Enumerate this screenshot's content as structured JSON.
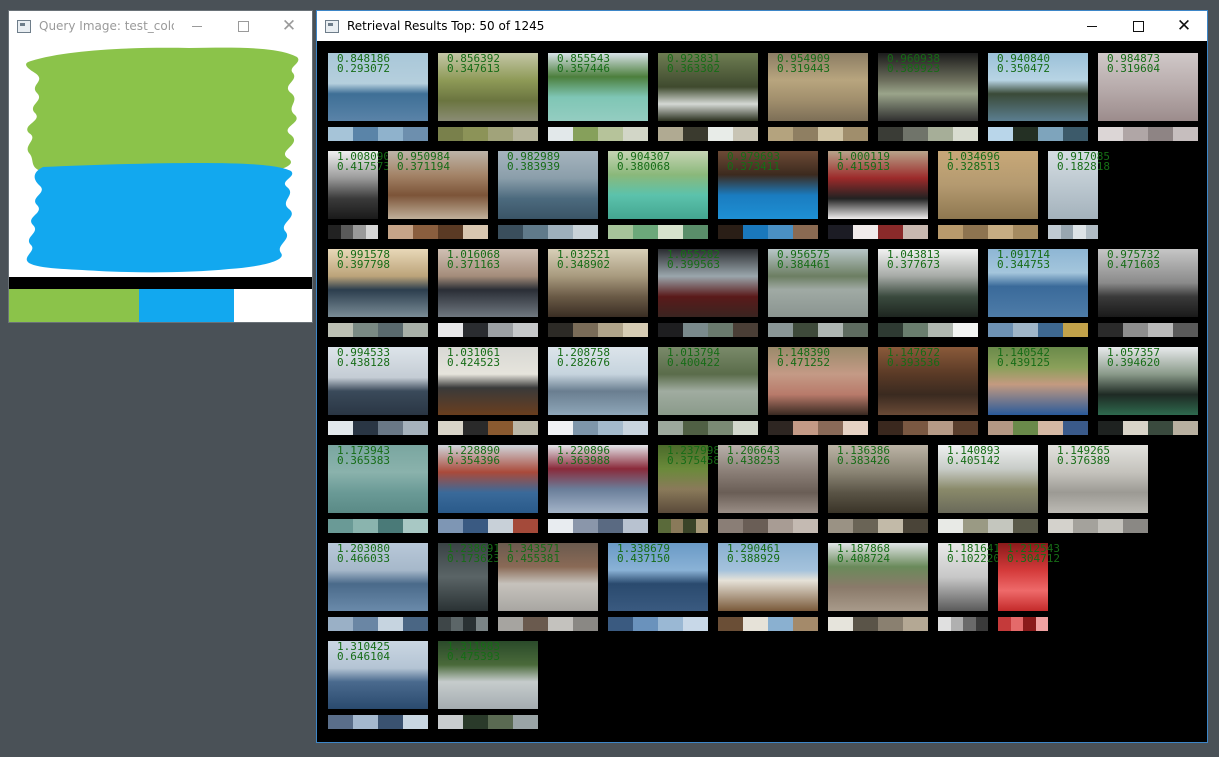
{
  "query_window": {
    "title": "Query Image: test_color...",
    "swatches": [
      "#8bc34a",
      "#12a8ef",
      "#ffffff"
    ]
  },
  "results_window": {
    "title": "Retrieval Results Top: 50 of 1245",
    "results": [
      {
        "s1": "0.848186",
        "s2": "0.293072",
        "img": "linear-gradient(#a9c7d8 0%,#b5cfdd 45%,#3e6f96 60%,#5a83a8 100%)",
        "colors": [
          "#a6c4d8",
          "#5a84a8",
          "#8fb2cc",
          "#6d8fae"
        ]
      },
      {
        "s1": "0.856392",
        "s2": "0.347613",
        "img": "linear-gradient(#c4c6a6 0%,#8e9a57 40%,#6b7540 70%,#8a8c74 100%)",
        "colors": [
          "#79804b",
          "#8c9358",
          "#a1a37a",
          "#b5b49a"
        ]
      },
      {
        "s1": "0.855543",
        "s2": "0.357446",
        "img": "linear-gradient(#d8e2e8 0%,#4c7f3c 35%,#7fc6b5 65%,#94cdc1 100%)",
        "colors": [
          "#e2e8ea",
          "#86a05b",
          "#b6c39a",
          "#d2d6c7"
        ]
      },
      {
        "s1": "0.923831",
        "s2": "0.363302",
        "img": "linear-gradient(#6e7d52 0%,#3f4a2e 50%,#d4d8d4 75%,#2c3220 100%)",
        "colors": [
          "#b0aa92",
          "#3a3a2e",
          "#e8ece8",
          "#c8c4b4"
        ]
      },
      {
        "s1": "0.954909",
        "s2": "0.319443",
        "img": "linear-gradient(#8c7d64 0%,#b8a57e 40%,#a08e6c 70%,#7d6f57 100%)",
        "colors": [
          "#b4a37e",
          "#8f7f62",
          "#d0c4a4",
          "#a08e6c"
        ]
      },
      {
        "s1": "0.960938",
        "s2": "0.389923",
        "img": "linear-gradient(#1c1c1c 0%,#6c6e5c 40%,#9aa48a 60%,#303030 100%)",
        "colors": [
          "#3a3c36",
          "#70746a",
          "#a6ae98",
          "#d8dcd0"
        ]
      },
      {
        "s1": "0.940840",
        "s2": "0.350472",
        "img": "linear-gradient(#9bc1d9 0%,#b8d4e4 40%,#3a4a38 60%,#5b7e90 100%)",
        "colors": [
          "#b9d6ea",
          "#243024",
          "#7ea4bc",
          "#3c5a6a"
        ]
      },
      {
        "s1": "0.984873",
        "s2": "0.319604",
        "img": "linear-gradient(#d0c8c8 0%,#b8acac 50%,#9c8c8c 100%)",
        "colors": [
          "#dcd6d6",
          "#b0a6a6",
          "#8e8484",
          "#c6bebe"
        ]
      },
      {
        "s1": "1.008090",
        "s2": "0.417573",
        "img": "linear-gradient(#f0f0f0 0%,#9a9a9a 40%,#3a3a3a 70%,#1a1a1a 100%)",
        "colors": [
          "#222222",
          "#5a5a5a",
          "#9a9a9a",
          "#d6d6d6"
        ]
      },
      {
        "s1": "0.950984",
        "s2": "0.371194",
        "img": "linear-gradient(#bdb4a8 0%,#a48468 35%,#7c5438 65%,#c0b09a 100%)",
        "colors": [
          "#c6a488",
          "#8a5e3e",
          "#5a3a24",
          "#d8c6b0"
        ]
      },
      {
        "s1": "0.982989",
        "s2": "0.383939",
        "img": "linear-gradient(#a6b4be 0%,#8a9eaa 40%,#4c6a7e 70%,#3a5466 100%)",
        "colors": [
          "#3a4e5c",
          "#607a8a",
          "#9eb0bc",
          "#c8d2d8"
        ]
      },
      {
        "s1": "0.904307",
        "s2": "0.380068",
        "img": "linear-gradient(#c6d4b4 0%,#8ab87a 35%,#5bc2ac 65%,#44a690 100%)",
        "colors": [
          "#a6c49a",
          "#6ca87a",
          "#d6e2cc",
          "#5a8e6a"
        ]
      },
      {
        "s1": "0.979693",
        "s2": "0.373411",
        "img": "linear-gradient(#6c4a36 0%,#3c2a1e 35%,#1a7cc0 65%,#1e90d4 100%)",
        "colors": [
          "#2a1e16",
          "#1a78bc",
          "#4a90c4",
          "#8a6a52"
        ]
      },
      {
        "s1": "1.000119",
        "s2": "0.415913",
        "img": "linear-gradient(#b8a48a 0%,#9c2a2a 40%,#222222 70%,#f0eeee 100%)",
        "colors": [
          "#1c1c24",
          "#f0eaea",
          "#8a2a2a",
          "#c8b8b0"
        ]
      },
      {
        "s1": "1.034696",
        "s2": "0.328513",
        "img": "linear-gradient(#c8a878 0%,#b49a70 50%,#8e7850 100%)",
        "colors": [
          "#b89a6c",
          "#8e7450",
          "#c6ac82",
          "#a48a60"
        ]
      },
      {
        "s1": "0.917085",
        "s2": "0.182818",
        "img": "linear-gradient(#d6dde2 0%,#bcc8d0 50%,#a4b2bc 100%)",
        "colors": [
          "#c0cad2",
          "#98a6b0",
          "#dce2e6",
          "#b0bcc4"
        ]
      },
      {
        "s1": "0.991578",
        "s2": "0.397798",
        "img": "linear-gradient(#e8d8b8 0%,#bca47a 40%,#2c3e4e 60%,#7a8c96 100%)",
        "colors": [
          "#bcc0b4",
          "#7a8a84",
          "#5a6a6e",
          "#a8b0a8"
        ]
      },
      {
        "s1": "1.016068",
        "s2": "0.371163",
        "img": "linear-gradient(#d0c0b4 0%,#a48c7a 40%,#2a2e36 60%,#707880 100%)",
        "colors": [
          "#e8e8ea",
          "#2a2c30",
          "#9ca0a4",
          "#c6c8ca"
        ]
      },
      {
        "s1": "1.032521",
        "s2": "0.348902",
        "img": "linear-gradient(#d8d0b8 0%,#a89a7e 40%,#6a5a46 70%,#3a2e24 100%)",
        "colors": [
          "#2c2a26",
          "#7a6c58",
          "#b0a48a",
          "#d6ccb4"
        ]
      },
      {
        "s1": "1.055282",
        "s2": "0.399563",
        "img": "linear-gradient(#2a2c30 0%,#9aa6ac 40%,#5a1a1a 70%,#3a2420 100%)",
        "colors": [
          "#1e1e20",
          "#7a8a8c",
          "#6a7a6e",
          "#4a3e36"
        ]
      },
      {
        "s1": "0.956575",
        "s2": "0.384461",
        "img": "linear-gradient(#b8c6c8 0%,#6c7e62 40%,#a0aaa4 60%,#8a9490 100%)",
        "colors": [
          "#8a9696",
          "#3e4a3a",
          "#aeb6b2",
          "#5e6c60"
        ]
      },
      {
        "s1": "1.043813",
        "s2": "0.377673",
        "img": "linear-gradient(#f2f2f2 0%,#a6aaa6 40%,#3a4a3e 70%,#1e2620 100%)",
        "colors": [
          "#2e3a32",
          "#6a7e6e",
          "#b0b8b0",
          "#f2f4f2"
        ]
      },
      {
        "s1": "1.091714",
        "s2": "0.344753",
        "img": "linear-gradient(#8eb6d4 0%,#a4c6dc 35%,#3a6a9a 55%,#4e7ca8 100%)",
        "colors": [
          "#6e92b4",
          "#a0b6c8",
          "#3e6890",
          "#c2a24a"
        ]
      },
      {
        "s1": "0.975732",
        "s2": "0.471603",
        "img": "linear-gradient(#c6c6c6 0%,#8a8a8a 50%,#3a3a3a 70%,#1a1a1a 100%)",
        "colors": [
          "#2a2a2a",
          "#8e8e8e",
          "#bababa",
          "#5a5a5a"
        ]
      },
      {
        "s1": "0.994533",
        "s2": "0.438128",
        "img": "linear-gradient(#dde4ea 0%,#c4ccd4 45%,#3a4a5a 65%,#2a3644 100%)",
        "colors": [
          "#e2e8ec",
          "#2a3644",
          "#6a7886",
          "#a6b2bc"
        ]
      },
      {
        "s1": "1.031061",
        "s2": "0.424523",
        "img": "linear-gradient(#d8d8d4 0%,#e6e4dc 40%,#3a3a3a 60%,#6a3e1e 100%)",
        "colors": [
          "#d8d4c8",
          "#2a2a2a",
          "#8a5a30",
          "#bcb8a8"
        ]
      },
      {
        "s1": "1.208758",
        "s2": "0.282676",
        "img": "linear-gradient(#dce4ea 0%,#c6d4de 40%,#6a7e90 65%,#8ea6b8 100%)",
        "colors": [
          "#f0f2f4",
          "#7e96aa",
          "#a4bacc",
          "#c8d4de"
        ]
      },
      {
        "s1": "1.013794",
        "s2": "0.400422",
        "img": "linear-gradient(#7a8a6a 0%,#5a6c4a 40%,#a0aca0 65%,#8a9a8a 100%)",
        "colors": [
          "#9ca89c",
          "#506044",
          "#7a8a74",
          "#d2d8cc"
        ]
      },
      {
        "s1": "1.148390",
        "s2": "0.471252",
        "img": "linear-gradient(#9a8a6a 0%,#c49a86 40%,#b87a6a 70%,#3a2a22 100%)",
        "colors": [
          "#2e2622",
          "#c49a86",
          "#8a6a58",
          "#e6d2c4"
        ]
      },
      {
        "s1": "1.147672",
        "s2": "0.393536",
        "img": "linear-gradient(#8a5a3a 0%,#5a3a26 40%,#3a2a20 70%,#6a4a36 100%)",
        "colors": [
          "#3a281e",
          "#7a5842",
          "#b69a86",
          "#5a3e2c"
        ]
      },
      {
        "s1": "1.140542",
        "s2": "0.439125",
        "img": "linear-gradient(#6a8a4a 0%,#8aa05a 30%,#c49a80 55%,#2a5a9a 100%)",
        "colors": [
          "#b49884",
          "#6a8a4a",
          "#d4b8a4",
          "#3a5a8a"
        ]
      },
      {
        "s1": "1.057357",
        "s2": "0.394620",
        "img": "linear-gradient(#e8eaec 0%,#8a9a8a 40%,#1e2a24 70%,#2e6a4e 100%)",
        "colors": [
          "#1e2220",
          "#d8d4c8",
          "#3a4a3e",
          "#b8b0a0"
        ]
      },
      {
        "s1": "1.173943",
        "s2": "0.365383",
        "img": "linear-gradient(#7aa6a0 0%,#8ab2ac 40%,#6a9a96 70%,#5a8a86 100%)",
        "colors": [
          "#6a9a96",
          "#8ab4ae",
          "#4a7a78",
          "#a8c8c4"
        ]
      },
      {
        "s1": "1.228890",
        "s2": "0.354396",
        "img": "linear-gradient(#d0d6dc 0%,#aa4a3a 40%,#3a6a9a 70%,#2a5a8a 100%)",
        "colors": [
          "#7e96b4",
          "#3a5a82",
          "#c8d0d8",
          "#a44a3a"
        ]
      },
      {
        "s1": "1.220896",
        "s2": "0.363988",
        "img": "linear-gradient(#e4e6ea 0%,#8a2a3a 35%,#6a7e9a 65%,#a4b4c8 100%)",
        "colors": [
          "#e8ecf0",
          "#8a96aa",
          "#5a6a82",
          "#b8c2d0"
        ]
      },
      {
        "s1": "1.237998",
        "s2": "0.375458",
        "img": "linear-gradient(#4a6a2a 0%,#6a8a3a 35%,#8a7a5a 65%,#5a4a3a 100%)",
        "colors": [
          "#5a6a3a",
          "#8a7a5a",
          "#3a4428",
          "#a89a7a"
        ]
      },
      {
        "s1": "1.206643",
        "s2": "0.438253",
        "img": "linear-gradient(#b8b0aa 0%,#8a7e76 40%,#6a5e56 70%,#9a8e86 100%)",
        "colors": [
          "#8a7e76",
          "#6a5e56",
          "#a89c94",
          "#c4bab2"
        ]
      },
      {
        "s1": "1.136386",
        "s2": "0.383426",
        "img": "linear-gradient(#bcb4a6 0%,#8a8474 40%,#5a5446 70%,#3a3428 100%)",
        "colors": [
          "#9a9284",
          "#6a6456",
          "#c2baa8",
          "#4a4438"
        ]
      },
      {
        "s1": "1.140893",
        "s2": "0.405142",
        "img": "linear-gradient(#eef0f0 0%,#c8ccc8 35%,#8a8a6a 65%,#6a6a5a 100%)",
        "colors": [
          "#e8eae6",
          "#9a9a84",
          "#c4c6be",
          "#5a5a4a"
        ]
      },
      {
        "s1": "1.149265",
        "s2": "0.376389",
        "img": "linear-gradient(#e2e2de 0%,#c4c2bc 40%,#9c9a94 70%,#bcbab4 100%)",
        "colors": [
          "#d4d2cc",
          "#a4a29c",
          "#c4c2bc",
          "#8a8884"
        ]
      },
      {
        "s1": "1.203080",
        "s2": "0.466033",
        "img": "linear-gradient(#b8c8d8 0%,#a6b8ca 40%,#4a6a8a 60%,#6a8aaa 100%)",
        "colors": [
          "#9ab0c6",
          "#6a86a4",
          "#c6d4e0",
          "#4a6684"
        ]
      },
      {
        "s1": "1.238691",
        "s2": "0.173623",
        "img": "linear-gradient(#3a4244 0%,#5a6466 50%,#2a3234 100%)",
        "colors": [
          "#3e4648",
          "#5c6668",
          "#2a3234",
          "#7a8486"
        ]
      },
      {
        "s1": "1.343571",
        "s2": "0.455381",
        "img": "linear-gradient(#6a5a4e 0%,#8a6a56 35%,#c6c2bc 60%,#a8a6a2 100%)",
        "colors": [
          "#a6a4a0",
          "#6a5a4e",
          "#c4c2be",
          "#8a8884"
        ]
      },
      {
        "s1": "1.338679",
        "s2": "0.437150",
        "img": "linear-gradient(#6a9ac6 0%,#8ab2d6 40%,#2a4a6e 60%,#3a5a80 100%)",
        "colors": [
          "#3a5a80",
          "#6a92bc",
          "#9ab8d4",
          "#c8d8e8"
        ]
      },
      {
        "s1": "1.290461",
        "s2": "0.388929",
        "img": "linear-gradient(#8ab0d0 0%,#a4c2dc 40%,#e6e2d8 55%,#7a5a3a 100%)",
        "colors": [
          "#6a4e36",
          "#e6e2d8",
          "#8ab0d0",
          "#a48a6a"
        ]
      },
      {
        "s1": "1.187868",
        "s2": "0.408724",
        "img": "linear-gradient(#e2e6e8 0%,#6a8a5a 35%,#8a7a6a 65%,#a89a8a 100%)",
        "colors": [
          "#e6e4dc",
          "#5a5448",
          "#8a8070",
          "#b4a894"
        ]
      },
      {
        "s1": "1.181641",
        "s2": "0.102220",
        "img": "linear-gradient(#e8e8e8 0%,#c8c8c8 50%,#5a5a5a 100%)",
        "colors": [
          "#e0e0e0",
          "#b0b0b0",
          "#6a6a6a",
          "#3a3a3a"
        ]
      },
      {
        "s1": "1.212543",
        "s2": "0.304712",
        "img": "linear-gradient(#8a1a1a 0%,#d43a3a 40%,#ee6a6a 70%,#c42a2a 100%)",
        "colors": [
          "#c43a3a",
          "#e46a6a",
          "#8a1a1a",
          "#f0a0a0"
        ]
      },
      {
        "s1": "1.310425",
        "s2": "0.646104",
        "img": "linear-gradient(#cad6e2 0%,#b4c4d4 40%,#4a6a8e 60%,#2a4a6e 100%)",
        "colors": [
          "#5a6e8a",
          "#a4b8ce",
          "#3a5270",
          "#c8d6e2"
        ]
      },
      {
        "s1": "1.311983",
        "s2": "0.475393",
        "img": "linear-gradient(#2a4a2a 0%,#4a6a3a 35%,#c6cccc 60%,#a4acb0 100%)",
        "colors": [
          "#c8ccce",
          "#2a3a2a",
          "#5a6a52",
          "#9aa4a6"
        ]
      }
    ]
  }
}
